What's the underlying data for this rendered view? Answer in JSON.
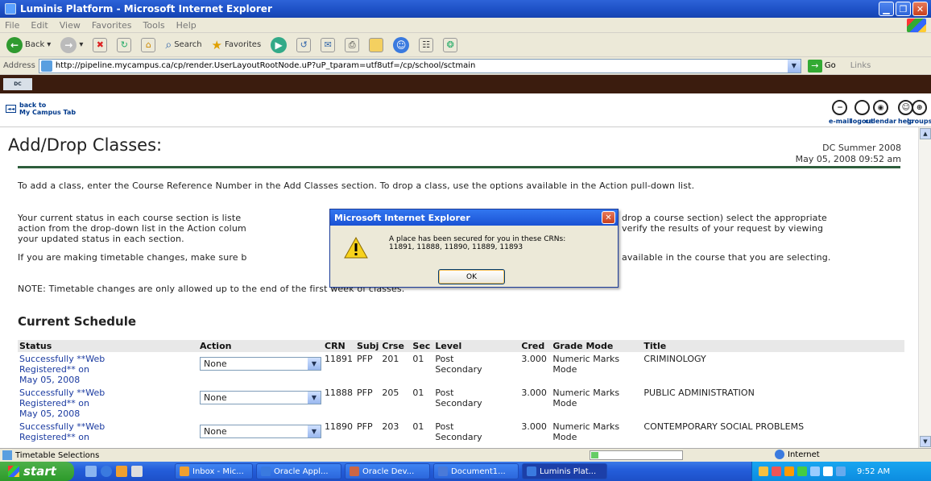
{
  "window": {
    "title": "Luminis Platform - Microsoft Internet Explorer"
  },
  "menu": [
    "File",
    "Edit",
    "View",
    "Favorites",
    "Tools",
    "Help"
  ],
  "toolbar": {
    "back": "Back",
    "search": "Search",
    "favorites": "Favorites"
  },
  "address": {
    "label": "Address",
    "url": "http://pipeline.mycampus.ca/cp/render.UserLayoutRootNode.uP?uP_tparam=utf8utf=/cp/school/sctmain",
    "go": "Go",
    "links": "Links"
  },
  "header": {
    "back_line1": "back to",
    "back_line2": "My Campus Tab",
    "back_icon": "◄◄",
    "nav": [
      {
        "label": "e-mail",
        "icon": "envelope-icon"
      },
      {
        "label": "calendar",
        "icon": "calendar-icon"
      },
      {
        "label": "groups",
        "icon": "groups-icon"
      },
      {
        "label": "logout",
        "icon": "logout-icon"
      },
      {
        "label": "help",
        "icon": "help-icon"
      }
    ]
  },
  "page": {
    "title": "Add/Drop Classes:",
    "term": "DC Summer 2008",
    "datetime": "May 05, 2008 09:52 am",
    "para1": "To add a class, enter the Course Reference Number in the Add Classes section. To drop a class, use the options available in the Action pull-down list.",
    "para2_left_1": "Your current status in each course section is liste",
    "para2_left_2": "action from the drop-down list in the Action colum",
    "para2_left_3": "your updated status in each section.",
    "para2_right_1": "drop a course section) select the appropriate",
    "para2_right_2": "verify the results of your request by viewing",
    "para3_left": "If you are making timetable changes, make sure b",
    "para3_right": "available in the course that you are selecting.",
    "note": "NOTE: Timetable changes are only allowed up to the end of the first week of classes.",
    "schedule_heading": "Current Schedule"
  },
  "schedule": {
    "columns": [
      "Status",
      "Action",
      "CRN",
      "Subj",
      "Crse",
      "Sec",
      "Level",
      "Cred",
      "Grade Mode",
      "Title"
    ],
    "rows": [
      {
        "status_link": "Successfully",
        "status_line1": " **Web",
        "status_line2": "Registered** on",
        "status_line3": "May 05, 2008",
        "action": "None",
        "crn": "11891",
        "subj": "PFP",
        "crse": "201",
        "sec": "01",
        "level1": "Post",
        "level2": "Secondary",
        "cred": "3.000",
        "grade1": "Numeric Marks",
        "grade2": "Mode",
        "title": "CRIMINOLOGY"
      },
      {
        "status_link": "Successfully",
        "status_line1": " **Web",
        "status_line2": "Registered** on",
        "status_line3": "May 05, 2008",
        "action": "None",
        "crn": "11888",
        "subj": "PFP",
        "crse": "205",
        "sec": "01",
        "level1": "Post",
        "level2": "Secondary",
        "cred": "3.000",
        "grade1": "Numeric Marks",
        "grade2": "Mode",
        "title": "PUBLIC ADMINISTRATION"
      },
      {
        "status_link": "Successfully",
        "status_line1": " **Web",
        "status_line2": "Registered** on",
        "status_line3": "",
        "action": "None",
        "crn": "11890",
        "subj": "PFP",
        "crse": "203",
        "sec": "01",
        "level1": "Post",
        "level2": "Secondary",
        "cred": "3.000",
        "grade1": "Numeric Marks",
        "grade2": "Mode",
        "title": "CONTEMPORARY SOCIAL PROBLEMS"
      }
    ]
  },
  "dialog": {
    "title": "Microsoft Internet Explorer",
    "line1": "A place has been secured for you in these CRNs:",
    "line2": "11891, 11888, 11890, 11889, 11893",
    "ok": "OK",
    "icon": "warning-icon"
  },
  "status": {
    "text": "Timetable Selections",
    "zone": "Internet",
    "progress": 0.08
  },
  "taskbar": {
    "start": "start",
    "tasks": [
      "Inbox - Mic...",
      "Oracle Appl...",
      "Oracle Dev...",
      "Document1...",
      "Luminis Plat..."
    ],
    "time": "9:52 AM"
  },
  "colors": {
    "title_blue": "#1c4fc4",
    "rule_green": "#2e5e3c",
    "link_blue": "#1a3aa0",
    "header_brown": "#3b1c0e"
  }
}
